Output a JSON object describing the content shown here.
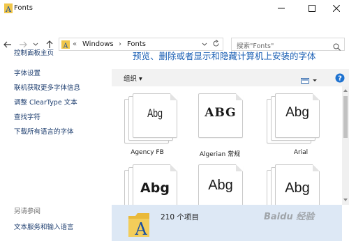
{
  "window": {
    "title": "Fonts"
  },
  "nav": {
    "path": [
      "Windows",
      "Fonts"
    ],
    "overflow_glyph": "«",
    "search_placeholder": "搜索\"Fonts\""
  },
  "left_pane": {
    "home": "控制面板主页",
    "links": [
      "字体设置",
      "联机获取更多字体信息",
      "调整 ClearType 文本",
      "查找字符",
      "下载所有语言的字体"
    ],
    "see_also": "另请参阅",
    "see_also_links": [
      "文本服务和输入语言"
    ]
  },
  "main": {
    "heading": "预览、删除或者显示和隐藏计算机上安装的字体",
    "organize_label": "组织 ▾",
    "fonts": [
      {
        "name": "Agency FB",
        "sample": "Abg"
      },
      {
        "name": "Algerian 常规",
        "sample": "ABG"
      },
      {
        "name": "Arial",
        "sample": "Abg"
      },
      {
        "name": "",
        "sample": "Abg"
      },
      {
        "name": "",
        "sample": "Abg"
      },
      {
        "name": "",
        "sample": "Abg"
      }
    ],
    "status_count": "210 个项目"
  },
  "watermark": "Baidu 经验",
  "icons": [
    "back-arrow-icon",
    "forward-arrow-icon",
    "recent-chevron-icon",
    "up-arrow-icon",
    "folder-icon",
    "refresh-icon",
    "search-icon",
    "view-icon",
    "help-icon",
    "minimize-icon",
    "maximize-icon",
    "close-icon",
    "fonts-folder-icon"
  ],
  "colors": {
    "link": "#1f3f70",
    "heading": "#1a5fb4",
    "status_bg": "#dde8f5",
    "toolbar_bg": "#f2f2f2",
    "help": "#1e72d0"
  }
}
